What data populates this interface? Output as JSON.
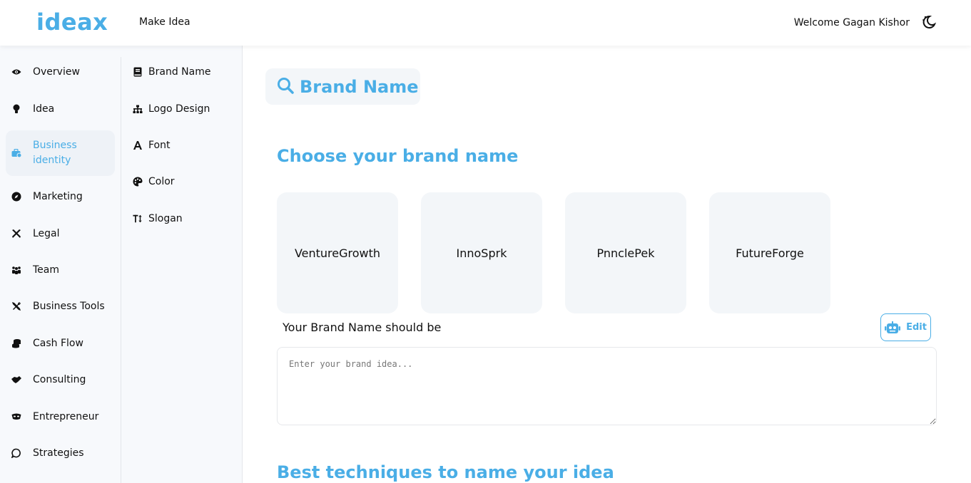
{
  "header": {
    "logo": "ideax",
    "make_idea": "Make Idea",
    "welcome": "Welcome Gagan Kishor"
  },
  "sidebar": {
    "items": [
      {
        "label": "Overview",
        "icon": "eye-icon"
      },
      {
        "label": "Idea",
        "icon": "lightbulb-icon"
      },
      {
        "label": "Business identity",
        "icon": "briefcase-icon",
        "active": true
      },
      {
        "label": "Marketing",
        "icon": "compass-icon"
      },
      {
        "label": "Legal",
        "icon": "tools-icon"
      },
      {
        "label": "Team",
        "icon": "team-icon"
      },
      {
        "label": "Business Tools",
        "icon": "screwdriver-wrench-icon"
      },
      {
        "label": "Cash Flow",
        "icon": "coins-icon"
      },
      {
        "label": "Consulting",
        "icon": "handshake-icon"
      },
      {
        "label": "Entrepreneur",
        "icon": "mask-icon"
      },
      {
        "label": "Strategies",
        "icon": "chat-icon"
      }
    ]
  },
  "subnav": {
    "items": [
      {
        "label": "Brand Name",
        "icon": "book-icon"
      },
      {
        "label": "Logo Design",
        "icon": "sitemap-icon"
      },
      {
        "label": "Font",
        "icon": "font-icon"
      },
      {
        "label": "Color",
        "icon": "palette-icon"
      },
      {
        "label": "Slogan",
        "icon": "text-height-icon"
      }
    ]
  },
  "main": {
    "title": "Brand Name",
    "choose_heading": "Choose your brand name",
    "names": [
      "VentureGrowth",
      "InnoSprk",
      "PnnclePek",
      "FutureForge"
    ],
    "should_be": "Your Brand Name should be",
    "edit_label": "Edit",
    "input_placeholder": "Enter your brand idea...",
    "techniques_heading": "Best techniques to name your idea"
  },
  "colors": {
    "accent": "#4aaee6",
    "sidebar_bg": "#f7f9fc",
    "card_bg": "#f3f6f9"
  }
}
